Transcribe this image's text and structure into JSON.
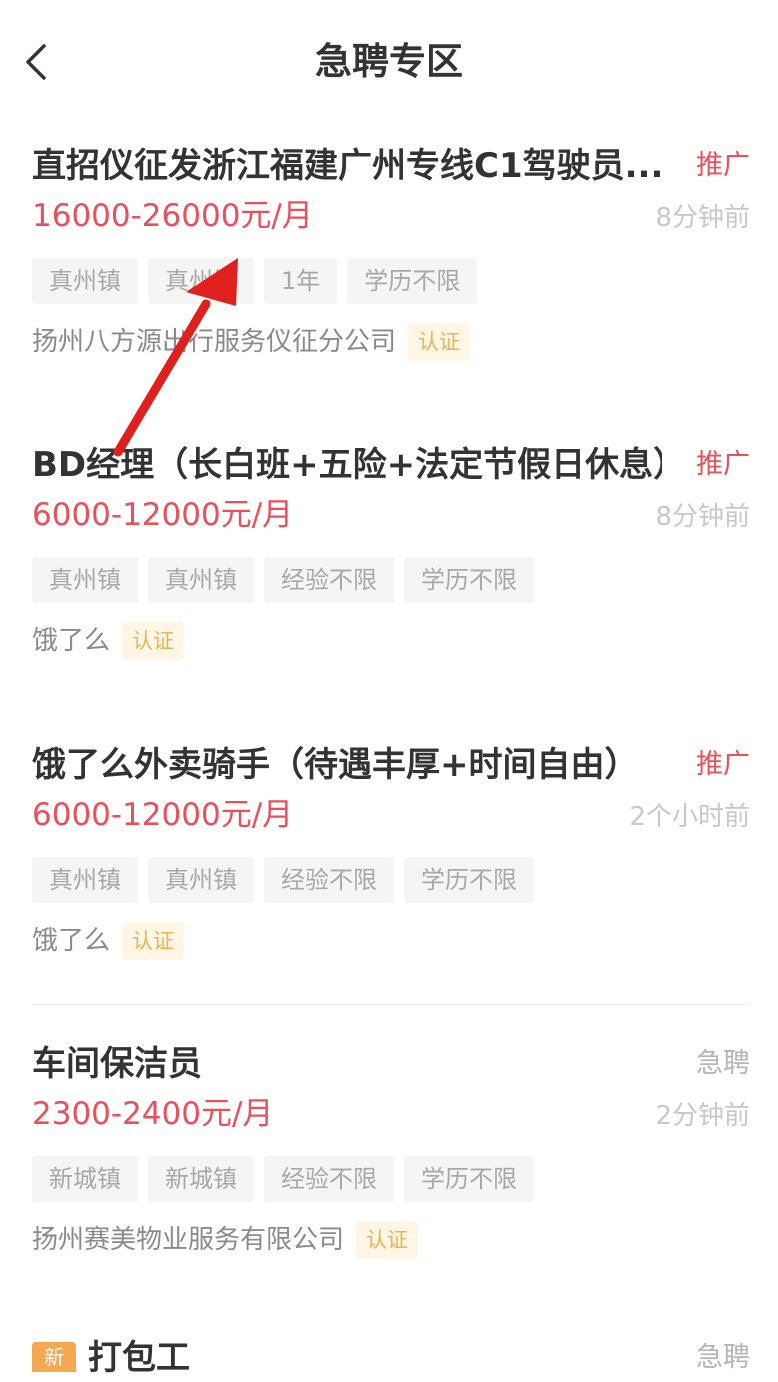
{
  "header": {
    "title": "急聘专区",
    "back_icon": "chevron-left-icon"
  },
  "jobs": [
    {
      "title": "直招仪征发浙江福建广州专线C1驾驶员...",
      "badge": "推广",
      "salary": "16000-26000元/月",
      "time": "8分钟前",
      "tags": [
        "真州镇",
        "真州镇",
        "1年",
        "学历不限"
      ],
      "company": "扬州八方源出行服务仪征分公司",
      "verified": "认证"
    },
    {
      "title": "BD经理（长白班+五险+法定节假日休息）",
      "badge": "推广",
      "salary": "6000-12000元/月",
      "time": "8分钟前",
      "tags": [
        "真州镇",
        "真州镇",
        "经验不限",
        "学历不限"
      ],
      "company": "饿了么",
      "verified": "认证"
    },
    {
      "title": "饿了么外卖骑手（待遇丰厚+时间自由）",
      "badge": "推广",
      "salary": "6000-12000元/月",
      "time": "2个小时前",
      "tags": [
        "真州镇",
        "真州镇",
        "经验不限",
        "学历不限"
      ],
      "company": "饿了么",
      "verified": "认证"
    },
    {
      "title": "车间保洁员",
      "badge": "急聘",
      "salary": "2300-2400元/月",
      "time": "2分钟前",
      "tags": [
        "新城镇",
        "新城镇",
        "经验不限",
        "学历不限"
      ],
      "company": "扬州赛美物业服务有限公司",
      "verified": "认证"
    }
  ],
  "partial_job": {
    "new_label": "新",
    "title": "打包工",
    "badge": "急聘"
  },
  "colors": {
    "accent_red": "#e8505b",
    "verify_text": "#e8b45a",
    "verify_bg": "#fff6e6",
    "annotation_arrow": "#e0201c"
  }
}
